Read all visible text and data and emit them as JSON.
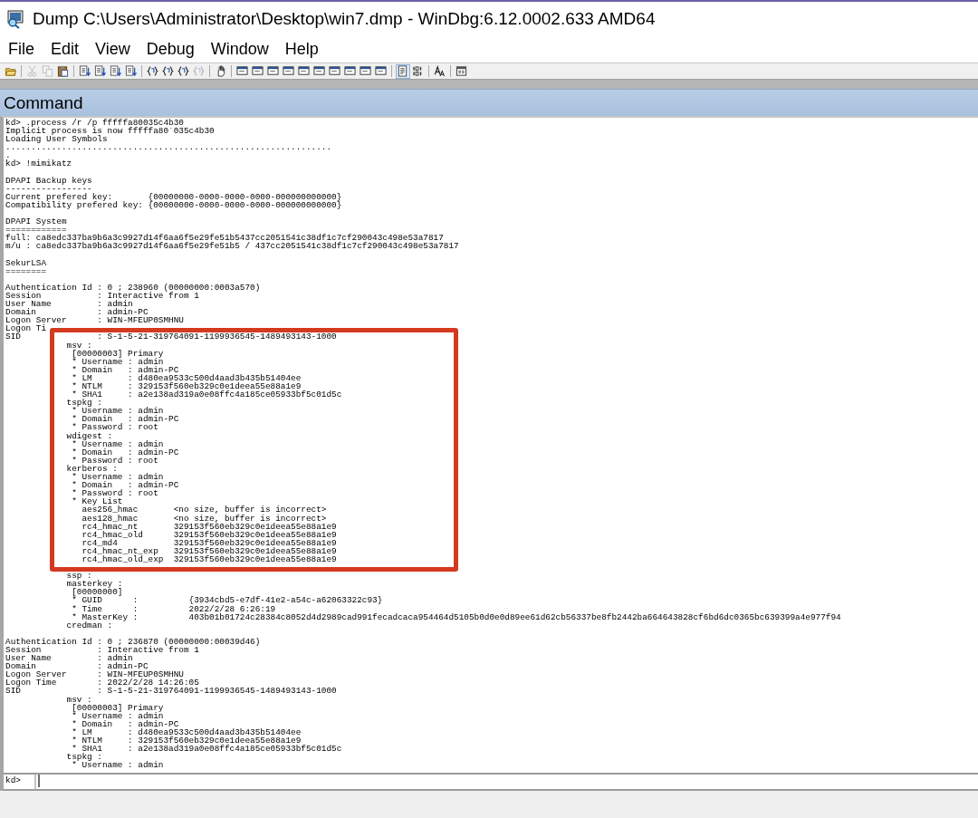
{
  "window": {
    "title": "Dump C:\\Users\\Administrator\\Desktop\\win7.dmp - WinDbg:6.12.0002.633 AMD64"
  },
  "menu": [
    "File",
    "Edit",
    "View",
    "Debug",
    "Window",
    "Help"
  ],
  "toolbar": {
    "groups": [
      [
        {
          "kind": "folder",
          "disabled": false,
          "pressed": false
        }
      ],
      [
        {
          "kind": "scissors",
          "disabled": true,
          "pressed": false
        },
        {
          "kind": "copy",
          "disabled": true,
          "pressed": false
        },
        {
          "kind": "clipboard",
          "disabled": false,
          "pressed": false
        }
      ],
      [
        {
          "kind": "list",
          "disabled": false,
          "pressed": false
        },
        {
          "kind": "list",
          "disabled": false,
          "pressed": false
        },
        {
          "kind": "list",
          "disabled": false,
          "pressed": false
        },
        {
          "kind": "list",
          "disabled": false,
          "pressed": false
        }
      ],
      [
        {
          "kind": "brace",
          "disabled": false,
          "pressed": false
        },
        {
          "kind": "brace",
          "disabled": false,
          "pressed": false
        },
        {
          "kind": "brace",
          "disabled": false,
          "pressed": false
        },
        {
          "kind": "brace",
          "disabled": true,
          "pressed": false
        }
      ],
      [
        {
          "kind": "hand",
          "disabled": false,
          "pressed": false
        }
      ],
      [
        {
          "kind": "window",
          "disabled": false,
          "pressed": false
        },
        {
          "kind": "window",
          "disabled": false,
          "pressed": false
        },
        {
          "kind": "window",
          "disabled": false,
          "pressed": false
        },
        {
          "kind": "window",
          "disabled": false,
          "pressed": false
        },
        {
          "kind": "window",
          "disabled": false,
          "pressed": false
        },
        {
          "kind": "window",
          "disabled": false,
          "pressed": false
        },
        {
          "kind": "window",
          "disabled": false,
          "pressed": false
        },
        {
          "kind": "window",
          "disabled": false,
          "pressed": false
        },
        {
          "kind": "window",
          "disabled": false,
          "pressed": false
        },
        {
          "kind": "window",
          "disabled": false,
          "pressed": false
        }
      ],
      [
        {
          "kind": "page",
          "disabled": false,
          "pressed": true
        },
        {
          "kind": "binary",
          "disabled": false,
          "pressed": false
        }
      ],
      [
        {
          "kind": "font",
          "disabled": false,
          "pressed": false
        }
      ],
      [
        {
          "kind": "properties",
          "disabled": false,
          "pressed": false
        }
      ]
    ]
  },
  "command_window": {
    "title": "Command",
    "blocks": [
      {
        "kind": "plain",
        "lines": [
          "kd> .process /r /p fffffa80035c4b30",
          "Implicit process is now fffffa80`035c4b30",
          "Loading User Symbols",
          "................................................................",
          ".",
          "kd> !mimikatz"
        ]
      },
      {
        "kind": "blank"
      },
      {
        "kind": "plain",
        "lines": [
          "DPAPI Backup keys",
          "-----------------",
          "Current prefered key:       {00000000-0000-0000-0000-000000000000}",
          "Compatibility prefered key: {00000000-0000-0000-0000-000000000000}"
        ]
      },
      {
        "kind": "blank"
      },
      {
        "kind": "plain",
        "lines": [
          "DPAPI System",
          "============",
          "full: ca8edc337ba9b6a3c9927d14f6aa6f5e29fe51b5437cc2051541c38df1c7cf290043c498e53a7817",
          "m/u : ca8edc337ba9b6a3c9927d14f6aa6f5e29fe51b5 / 437cc2051541c38df1c7cf290043c498e53a7817"
        ]
      },
      {
        "kind": "blank"
      },
      {
        "kind": "plain",
        "lines": [
          "SekurLSA",
          "========"
        ]
      },
      {
        "kind": "blank"
      },
      {
        "kind": "plain",
        "lines": [
          "Authentication Id : 0 ; 238960 (00000000:0003a570)",
          "Session           : Interactive from 1",
          "User Name         : admin",
          "Domain            : admin-PC",
          "Logon Server      : WIN-MFEUP0SMHNU",
          "Logon Ti"
        ]
      },
      {
        "kind": "boxed",
        "lines": [
          "SID               : S-1-5-21-319764091-1199936545-1489493143-1000",
          "            msv :",
          "             [00000003] Primary",
          "             * Username : admin",
          "             * Domain   : admin-PC",
          "             * LM       : d480ea9533c500d4aad3b435b51404ee",
          "             * NTLM     : 329153f560eb329c0e1deea55e88a1e9",
          "             * SHA1     : a2e138ad319a0e08ffc4a185ce05933bf5c01d5c",
          "            tspkg :",
          "             * Username : admin",
          "             * Domain   : admin-PC",
          "             * Password : root",
          "            wdigest :",
          "             * Username : admin",
          "             * Domain   : admin-PC",
          "             * Password : root",
          "            kerberos :",
          "             * Username : admin",
          "             * Domain   : admin-PC",
          "             * Password : root",
          "             * Key List",
          "               aes256_hmac       <no size, buffer is incorrect>",
          "               aes128_hmac       <no size, buffer is incorrect>",
          "               rc4_hmac_nt       329153f560eb329c0e1deea55e88a1e9",
          "               rc4_hmac_old      329153f560eb329c0e1deea55e88a1e9",
          "               rc4_md4           329153f560eb329c0e1deea55e88a1e9",
          "               rc4_hmac_nt_exp   329153f560eb329c0e1deea55e88a1e9",
          "               rc4_hmac_old_exp  329153f560eb329c0e1deea55e88a1e9"
        ]
      },
      {
        "kind": "blank"
      },
      {
        "kind": "plain",
        "lines": [
          "            ssp :",
          "            masterkey :",
          "             [00000000]",
          "             * GUID      :          {3934cbd5-e7df-41e2-a54c-a62063322c93}",
          "             * Time      :          2022/2/28 6:26:19",
          "             * MasterKey :          403b01b01724c28384c8052d4d2989cad991fecadcaca954464d5105b0d0e0d89ee61d62cb56337be8fb2442ba664643828cf6bd6dc0365bc639399a4e977f94",
          "            credman :"
        ]
      },
      {
        "kind": "blank"
      },
      {
        "kind": "plain",
        "lines": [
          "Authentication Id : 0 ; 236870 (00000000:00039d46)",
          "Session           : Interactive from 1",
          "User Name         : admin",
          "Domain            : admin-PC",
          "Logon Server      : WIN-MFEUP0SMHNU",
          "Logon Time        : 2022/2/28 14:26:05",
          "SID               : S-1-5-21-319764091-1199936545-1489493143-1000",
          "            msv :",
          "             [00000003] Primary",
          "             * Username : admin",
          "             * Domain   : admin-PC",
          "             * LM       : d480ea9533c500d4aad3b435b51404ee",
          "             * NTLM     : 329153f560eb329c0e1deea55e88a1e9",
          "             * SHA1     : a2e138ad319a0e08ffc4a185ce05933bf5c01d5c",
          "            tspkg :",
          "             * Username : admin"
        ]
      }
    ],
    "prompt": "kd>"
  }
}
